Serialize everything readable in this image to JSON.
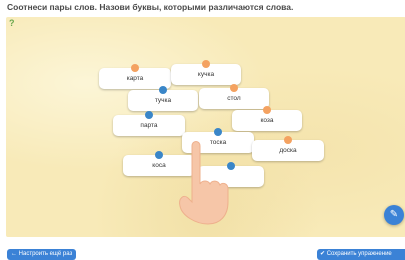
{
  "instruction": "Соотнеси пары слов. Назови буквы, которыми различаются слова.",
  "hint_icon": "hint-icon",
  "cards": [
    {
      "label": "карта",
      "dot": "orange"
    },
    {
      "label": "кучка",
      "dot": "orange"
    },
    {
      "label": "тучка",
      "dot": "blue"
    },
    {
      "label": "стол",
      "dot": "orange"
    },
    {
      "label": "парта",
      "dot": "blue"
    },
    {
      "label": "коза",
      "dot": "orange"
    },
    {
      "label": "тоска",
      "dot": "blue"
    },
    {
      "label": "доска",
      "dot": "orange"
    },
    {
      "label": "коса",
      "dot": "blue"
    },
    {
      "label": "",
      "dot": "blue"
    }
  ],
  "fab_icon": "edit-icon",
  "buttons": {
    "left_label": "← Настроить ещё раз",
    "right_label": "✔ Сохранить упражнение"
  },
  "colors": {
    "accent": "#3b82d6",
    "board": "#f8eab8",
    "dot_orange": "#f4a261",
    "dot_blue": "#3a86c8"
  }
}
